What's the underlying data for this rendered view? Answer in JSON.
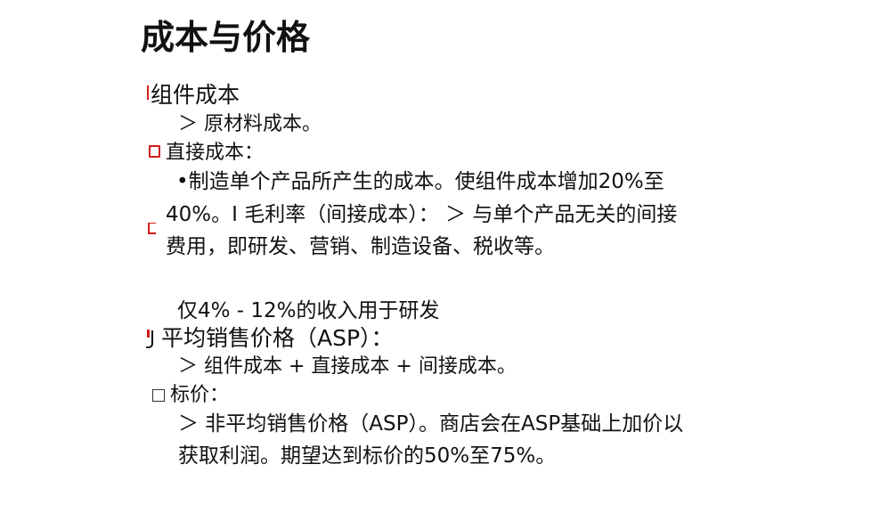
{
  "title": "成本与价格",
  "items": {
    "component_cost": "组件成本",
    "component_cost_sub": "＞ 原材料成本。",
    "direct_cost": "直接成本：",
    "direct_line1": "•制造单个产品所产生的成本。使组件成本增加20%至",
    "direct_line2": "40%。I 毛利率（间接成本）：  ＞ 与单个产品无关的间接",
    "direct_line3": "费用，即研发、营销、制造设备、税收等。",
    "rnd_note": "仅4% - 12%的收入用于研发",
    "asp": "平均销售价格（ASP）：",
    "asp_sub": "＞ 组件成本 + 直接成本 + 间接成本。",
    "list_price": "标价：",
    "list_line1": "＞ 非平均销售价格（ASP）。商店会在ASP基础上加价以",
    "list_line2": "获取利润。期望达到标价的50%至75%。"
  },
  "colors": {
    "marker": "#d21b1b",
    "text": "#111111"
  }
}
